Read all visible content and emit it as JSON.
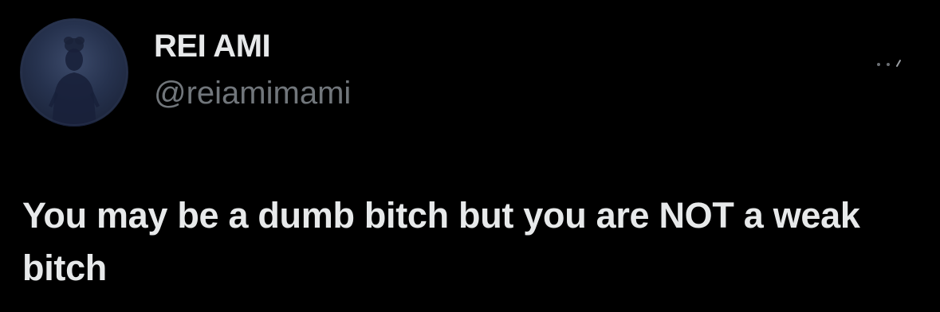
{
  "tweet": {
    "author": {
      "display_name": "REI AMI",
      "handle": "@reiamimami",
      "avatar_icon": "avatar-photo"
    },
    "text": "You may be a dumb bitch but you are NOT a weak bitch",
    "more_icon": "more-options-icon"
  },
  "colors": {
    "background": "#000000",
    "primary_text": "#e7e9ea",
    "secondary_text": "#71767b",
    "avatar_base": "#26324e"
  }
}
